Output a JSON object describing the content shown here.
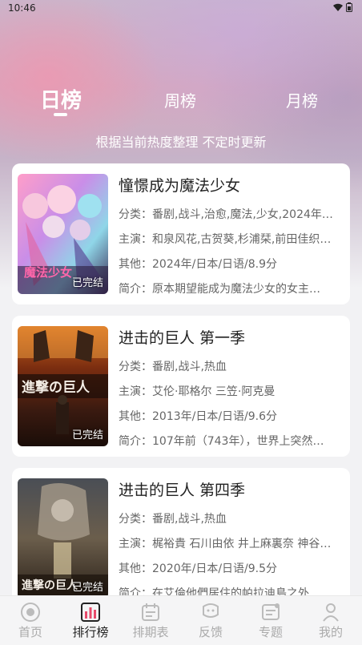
{
  "status_bar": {
    "time": "10:46"
  },
  "tabs": {
    "daily": "日榜",
    "weekly": "周榜",
    "monthly": "月榜"
  },
  "subtitle": "根据当前热度整理 不定时更新",
  "items": [
    {
      "title": "憧憬成为魔法少女",
      "category": "分类：番剧,战斗,治愈,魔法,少女,2024年…",
      "cast": "主演：和泉风花,古贺葵,杉浦栞,前田佳织…",
      "other": "其他：2024年/日本/日语/8.9分",
      "summary": "简介：原本期望能成为魔法少女的女主…",
      "status": "已完结",
      "poster_text": "魔法少女"
    },
    {
      "title": "进击的巨人 第一季",
      "category": "分类：番剧,战斗,热血",
      "cast": "主演：艾伦·耶格尔 三笠·阿克曼",
      "other": "其他：2013年/日本/日语/9.6分",
      "summary": "简介：107年前（743年），世界上突然…",
      "status": "已完结",
      "poster_text": "進撃の巨人"
    },
    {
      "title": "进击的巨人 第四季",
      "category": "分类：番剧,战斗,热血",
      "cast": "主演：梶裕貴 石川由依 井上麻裏奈 神谷…",
      "other": "其他：2020年/日本/日语/9.5分",
      "summary": "简介：在艾倫他們居住的帕拉迪島之外…",
      "status": "已完结",
      "poster_text": "進撃の巨人"
    }
  ],
  "nav": [
    {
      "label": "首页",
      "icon": "home-icon"
    },
    {
      "label": "排行榜",
      "icon": "ranking-icon",
      "active": true
    },
    {
      "label": "排期表",
      "icon": "calendar-icon"
    },
    {
      "label": "反馈",
      "icon": "feedback-icon"
    },
    {
      "label": "专题",
      "icon": "topic-icon"
    },
    {
      "label": "我的",
      "icon": "profile-icon"
    }
  ]
}
